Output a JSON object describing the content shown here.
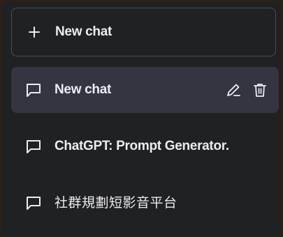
{
  "sidebar": {
    "new_chat_label": "New chat",
    "chats": [
      {
        "title": "New chat",
        "active": true
      },
      {
        "title": "ChatGPT: Prompt Generator."
      },
      {
        "title": "社群規劃短影音平台"
      }
    ]
  },
  "icons": {
    "new_chat": "plus-icon",
    "chat_item": "message-square-icon",
    "edit": "pencil-icon",
    "delete": "trash-icon"
  },
  "colors": {
    "sidebar_bg": "#202123",
    "active_item_bg": "#343541",
    "border": "#4d4d55",
    "text": "#ececf1",
    "outer_frame": "#2b2118"
  }
}
